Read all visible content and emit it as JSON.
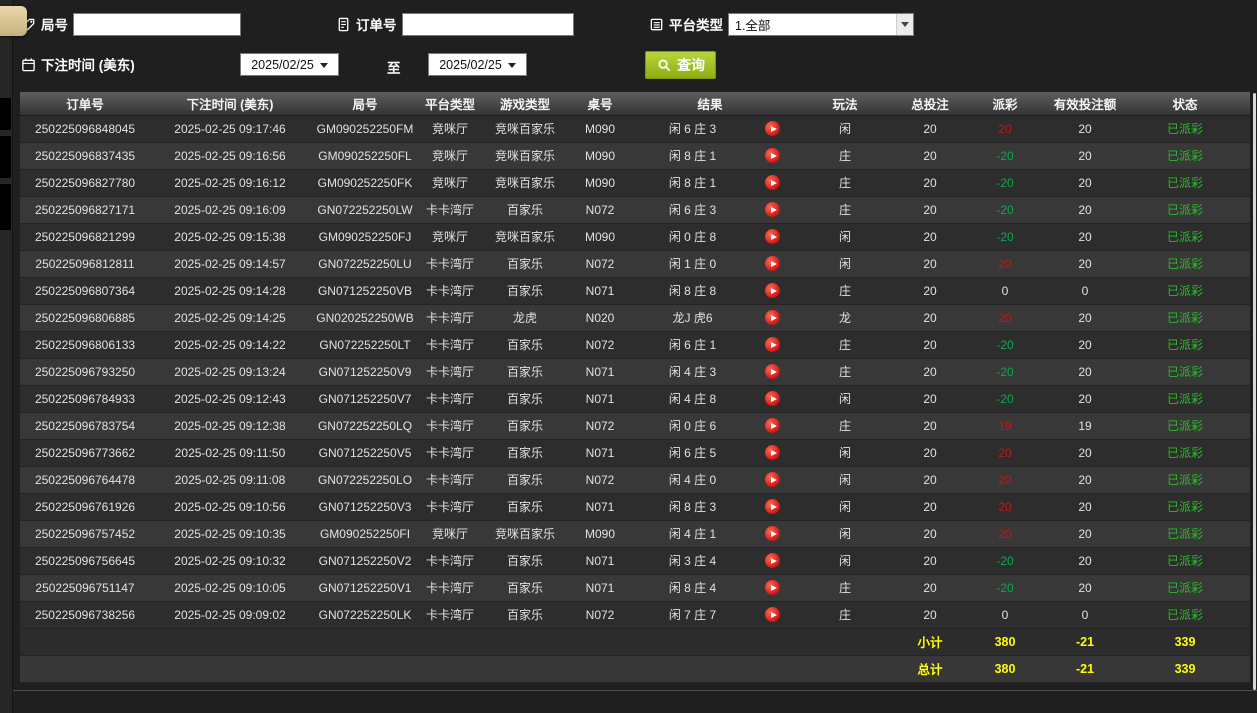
{
  "filters": {
    "round": {
      "label": "局号",
      "value": ""
    },
    "order": {
      "label": "订单号",
      "value": ""
    },
    "platform": {
      "label": "平台类型",
      "value": "1.全部"
    },
    "bet_time": {
      "label": "下注时间 (美东)",
      "from": "2025/02/25",
      "to_label": "至",
      "to": "2025/02/25"
    },
    "search_label": "查询"
  },
  "icons": {
    "round": "tag-icon",
    "order": "document-icon",
    "platform": "list-icon",
    "bet_time": "calendar-icon",
    "search": "magnifier-icon",
    "replay": "play-icon",
    "dropdown": "chevron-down-icon"
  },
  "table": {
    "headers": [
      "订单号",
      "下注时间 (美东)",
      "局号",
      "平台类型",
      "游戏类型",
      "桌号",
      "结果",
      "玩法",
      "总投注",
      "派彩",
      "有效投注额",
      "状态"
    ],
    "rows": [
      {
        "order_id": "250225096848045",
        "bet_time": "2025-02-25 09:17:46",
        "round_id": "GM090252250FM",
        "platform": "竞咪厅",
        "game_type": "竞咪百家乐",
        "table_no": "M090",
        "result": "闲 6 庄 3",
        "play": "闲",
        "total_bet": "20",
        "payout": "20",
        "payout_class": "win",
        "valid_bet": "20",
        "status": "已派彩"
      },
      {
        "order_id": "250225096837435",
        "bet_time": "2025-02-25 09:16:56",
        "round_id": "GM090252250FL",
        "platform": "竞咪厅",
        "game_type": "竞咪百家乐",
        "table_no": "M090",
        "result": "闲 8 庄 1",
        "play": "庄",
        "total_bet": "20",
        "payout": "-20",
        "payout_class": "loss",
        "valid_bet": "20",
        "status": "已派彩"
      },
      {
        "order_id": "250225096827780",
        "bet_time": "2025-02-25 09:16:12",
        "round_id": "GM090252250FK",
        "platform": "竞咪厅",
        "game_type": "竞咪百家乐",
        "table_no": "M090",
        "result": "闲 8 庄 1",
        "play": "庄",
        "total_bet": "20",
        "payout": "-20",
        "payout_class": "loss",
        "valid_bet": "20",
        "status": "已派彩"
      },
      {
        "order_id": "250225096827171",
        "bet_time": "2025-02-25 09:16:09",
        "round_id": "GN072252250LW",
        "platform": "卡卡湾厅",
        "game_type": "百家乐",
        "table_no": "N072",
        "result": "闲 6 庄 3",
        "play": "庄",
        "total_bet": "20",
        "payout": "-20",
        "payout_class": "loss",
        "valid_bet": "20",
        "status": "已派彩"
      },
      {
        "order_id": "250225096821299",
        "bet_time": "2025-02-25 09:15:38",
        "round_id": "GM090252250FJ",
        "platform": "竞咪厅",
        "game_type": "竞咪百家乐",
        "table_no": "M090",
        "result": "闲 0 庄 8",
        "play": "闲",
        "total_bet": "20",
        "payout": "-20",
        "payout_class": "loss",
        "valid_bet": "20",
        "status": "已派彩"
      },
      {
        "order_id": "250225096812811",
        "bet_time": "2025-02-25 09:14:57",
        "round_id": "GN072252250LU",
        "platform": "卡卡湾厅",
        "game_type": "百家乐",
        "table_no": "N072",
        "result": "闲 1 庄 0",
        "play": "闲",
        "total_bet": "20",
        "payout": "20",
        "payout_class": "win",
        "valid_bet": "20",
        "status": "已派彩"
      },
      {
        "order_id": "250225096807364",
        "bet_time": "2025-02-25 09:14:28",
        "round_id": "GN071252250VB",
        "platform": "卡卡湾厅",
        "game_type": "百家乐",
        "table_no": "N071",
        "result": "闲 8 庄 8",
        "play": "庄",
        "total_bet": "20",
        "payout": "0",
        "payout_class": "zero",
        "valid_bet": "0",
        "status": "已派彩"
      },
      {
        "order_id": "250225096806885",
        "bet_time": "2025-02-25 09:14:25",
        "round_id": "GN020252250WB",
        "platform": "卡卡湾厅",
        "game_type": "龙虎",
        "table_no": "N020",
        "result": "龙J 虎6",
        "play": "龙",
        "total_bet": "20",
        "payout": "20",
        "payout_class": "win",
        "valid_bet": "20",
        "status": "已派彩"
      },
      {
        "order_id": "250225096806133",
        "bet_time": "2025-02-25 09:14:22",
        "round_id": "GN072252250LT",
        "platform": "卡卡湾厅",
        "game_type": "百家乐",
        "table_no": "N072",
        "result": "闲 6 庄 1",
        "play": "庄",
        "total_bet": "20",
        "payout": "-20",
        "payout_class": "loss",
        "valid_bet": "20",
        "status": "已派彩"
      },
      {
        "order_id": "250225096793250",
        "bet_time": "2025-02-25 09:13:24",
        "round_id": "GN071252250V9",
        "platform": "卡卡湾厅",
        "game_type": "百家乐",
        "table_no": "N071",
        "result": "闲 4 庄 3",
        "play": "庄",
        "total_bet": "20",
        "payout": "-20",
        "payout_class": "loss",
        "valid_bet": "20",
        "status": "已派彩"
      },
      {
        "order_id": "250225096784933",
        "bet_time": "2025-02-25 09:12:43",
        "round_id": "GN071252250V7",
        "platform": "卡卡湾厅",
        "game_type": "百家乐",
        "table_no": "N071",
        "result": "闲 4 庄 8",
        "play": "闲",
        "total_bet": "20",
        "payout": "-20",
        "payout_class": "loss",
        "valid_bet": "20",
        "status": "已派彩"
      },
      {
        "order_id": "250225096783754",
        "bet_time": "2025-02-25 09:12:38",
        "round_id": "GN072252250LQ",
        "platform": "卡卡湾厅",
        "game_type": "百家乐",
        "table_no": "N072",
        "result": "闲 0 庄 6",
        "play": "庄",
        "total_bet": "20",
        "payout": "19",
        "payout_class": "win",
        "valid_bet": "19",
        "status": "已派彩"
      },
      {
        "order_id": "250225096773662",
        "bet_time": "2025-02-25 09:11:50",
        "round_id": "GN071252250V5",
        "platform": "卡卡湾厅",
        "game_type": "百家乐",
        "table_no": "N071",
        "result": "闲 6 庄 5",
        "play": "闲",
        "total_bet": "20",
        "payout": "20",
        "payout_class": "win",
        "valid_bet": "20",
        "status": "已派彩"
      },
      {
        "order_id": "250225096764478",
        "bet_time": "2025-02-25 09:11:08",
        "round_id": "GN072252250LO",
        "platform": "卡卡湾厅",
        "game_type": "百家乐",
        "table_no": "N072",
        "result": "闲 4 庄 0",
        "play": "闲",
        "total_bet": "20",
        "payout": "20",
        "payout_class": "win",
        "valid_bet": "20",
        "status": "已派彩"
      },
      {
        "order_id": "250225096761926",
        "bet_time": "2025-02-25 09:10:56",
        "round_id": "GN071252250V3",
        "platform": "卡卡湾厅",
        "game_type": "百家乐",
        "table_no": "N071",
        "result": "闲 8 庄 3",
        "play": "闲",
        "total_bet": "20",
        "payout": "20",
        "payout_class": "win",
        "valid_bet": "20",
        "status": "已派彩"
      },
      {
        "order_id": "250225096757452",
        "bet_time": "2025-02-25 09:10:35",
        "round_id": "GM090252250FI",
        "platform": "竞咪厅",
        "game_type": "竞咪百家乐",
        "table_no": "M090",
        "result": "闲 4 庄 1",
        "play": "闲",
        "total_bet": "20",
        "payout": "20",
        "payout_class": "win",
        "valid_bet": "20",
        "status": "已派彩"
      },
      {
        "order_id": "250225096756645",
        "bet_time": "2025-02-25 09:10:32",
        "round_id": "GN071252250V2",
        "platform": "卡卡湾厅",
        "game_type": "百家乐",
        "table_no": "N071",
        "result": "闲 3 庄 4",
        "play": "闲",
        "total_bet": "20",
        "payout": "-20",
        "payout_class": "loss",
        "valid_bet": "20",
        "status": "已派彩"
      },
      {
        "order_id": "250225096751147",
        "bet_time": "2025-02-25 09:10:05",
        "round_id": "GN071252250V1",
        "platform": "卡卡湾厅",
        "game_type": "百家乐",
        "table_no": "N071",
        "result": "闲 8 庄 4",
        "play": "庄",
        "total_bet": "20",
        "payout": "-20",
        "payout_class": "loss",
        "valid_bet": "20",
        "status": "已派彩"
      },
      {
        "order_id": "250225096738256",
        "bet_time": "2025-02-25 09:09:02",
        "round_id": "GN072252250LK",
        "platform": "卡卡湾厅",
        "game_type": "百家乐",
        "table_no": "N072",
        "result": "闲 7 庄 7",
        "play": "庄",
        "total_bet": "20",
        "payout": "0",
        "payout_class": "zero",
        "valid_bet": "0",
        "status": "已派彩"
      }
    ],
    "subtotal": {
      "label": "小计",
      "total_bet": "380",
      "payout": "-21",
      "valid_bet": "339"
    },
    "total": {
      "label": "总计",
      "total_bet": "380",
      "payout": "-21",
      "valid_bet": "339"
    }
  },
  "colors": {
    "search_button_green": "#9fc01f",
    "payout_win_red": "#c01818",
    "payout_loss_green": "#00b050",
    "status_green": "#2dbd2d",
    "totals_yellow": "#ffff00",
    "play_icon_red": "#cf1212"
  }
}
